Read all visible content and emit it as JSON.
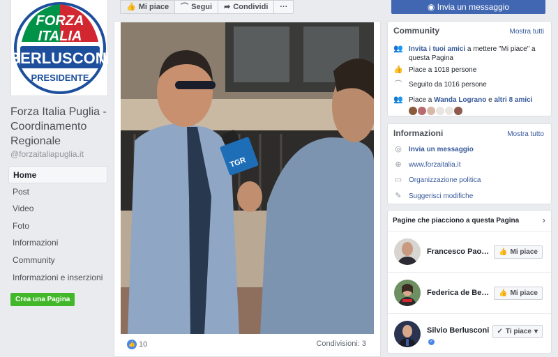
{
  "page": {
    "logo_lines": [
      "FORZA",
      "ITALIA",
      "BERLUSCONI",
      "PRESIDENTE"
    ],
    "name": "Forza Italia Puglia - Coordinamento Regionale",
    "handle": "@forzaitaliapuglia.it",
    "nav": [
      "Home",
      "Post",
      "Video",
      "Foto",
      "Informazioni",
      "Community",
      "Informazioni e inserzioni"
    ],
    "create_page": "Crea una Pagina"
  },
  "actionbar": {
    "like": "Mi piace",
    "follow": "Segui",
    "share": "Condividi",
    "more": "···",
    "message": "Invia un messaggio"
  },
  "post": {
    "mic_label": "TGR",
    "likes": "10",
    "shares": "Condivisioni: 3"
  },
  "community": {
    "title": "Community",
    "see_all": "Mostra tutti",
    "invite_link": "Invita i tuoi amici",
    "invite_rest": " a mettere \"Mi piace\" a questa Pagina",
    "likes": "Piace a 1018 persone",
    "followers": "Seguito da 1016 persone",
    "liked_by_prefix": "Piace a ",
    "liked_by_name": "Wanda Lograno",
    "liked_by_mid": " e ",
    "liked_by_more": "altri 8 amici"
  },
  "info": {
    "title": "Informazioni",
    "see_all": "Mostra tutto",
    "send_message": "Invia un messaggio",
    "website": "www.forzaitalia.it",
    "category": "Organizzazione politica",
    "suggest": "Suggerisci modifiche"
  },
  "liked_pages": {
    "title": "Pagine che piacciono a questa Pagina",
    "items": [
      {
        "name": "Francesco Paolo Sisto",
        "button": "Mi piace"
      },
      {
        "name": "Federica de Benedetto",
        "button": "Mi piace"
      },
      {
        "name": "Silvio Berlusconi",
        "button": "Ti piace"
      }
    ]
  },
  "colors": {
    "brand_blue": "#4267b2",
    "link_blue": "#365899",
    "green": "#42b72a",
    "logo_red": "#d22630",
    "logo_green": "#009246"
  }
}
